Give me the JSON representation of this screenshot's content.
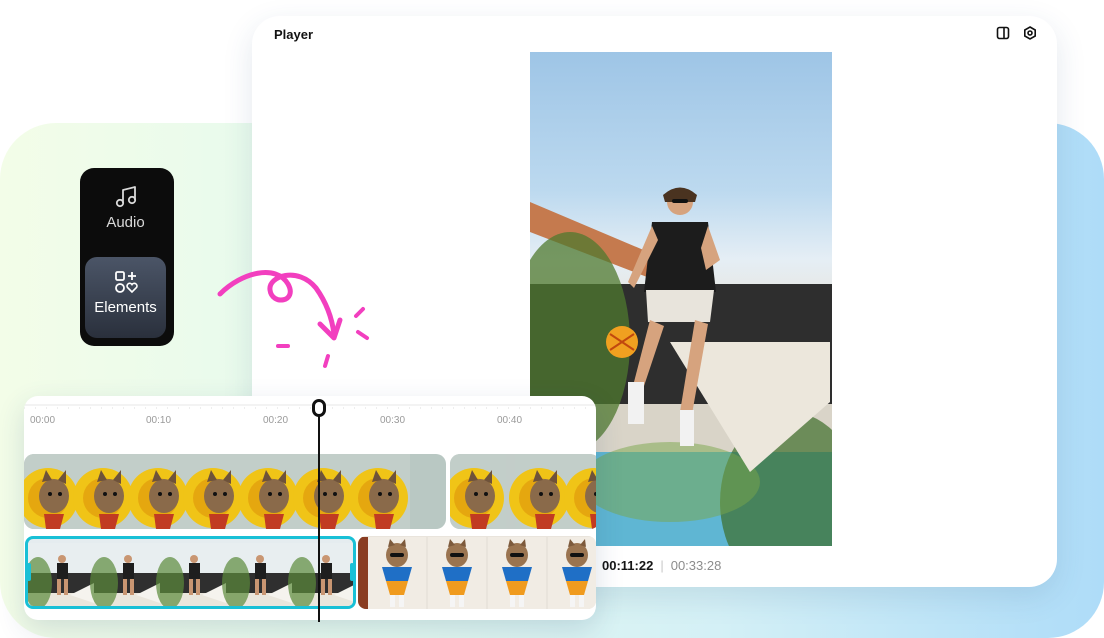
{
  "player": {
    "title": "Player",
    "current_time": "00:11:22",
    "separator": "|",
    "total_time": "00:33:28",
    "icons": [
      "split-view-icon",
      "settings-icon"
    ]
  },
  "side_menu": {
    "items": [
      {
        "label": "Audio",
        "icon": "music-note-icon"
      },
      {
        "label": "Elements",
        "icon": "elements-icon"
      }
    ]
  },
  "timeline": {
    "tick_labels": [
      "00:00",
      "00:10",
      "00:20",
      "00:30",
      "00:40"
    ]
  },
  "colors": {
    "accent": "#19c0d6",
    "decoration_pink": "#f23fbf",
    "panel_gradient_start": "#f3fde8",
    "panel_gradient_end": "#aedcf8"
  }
}
